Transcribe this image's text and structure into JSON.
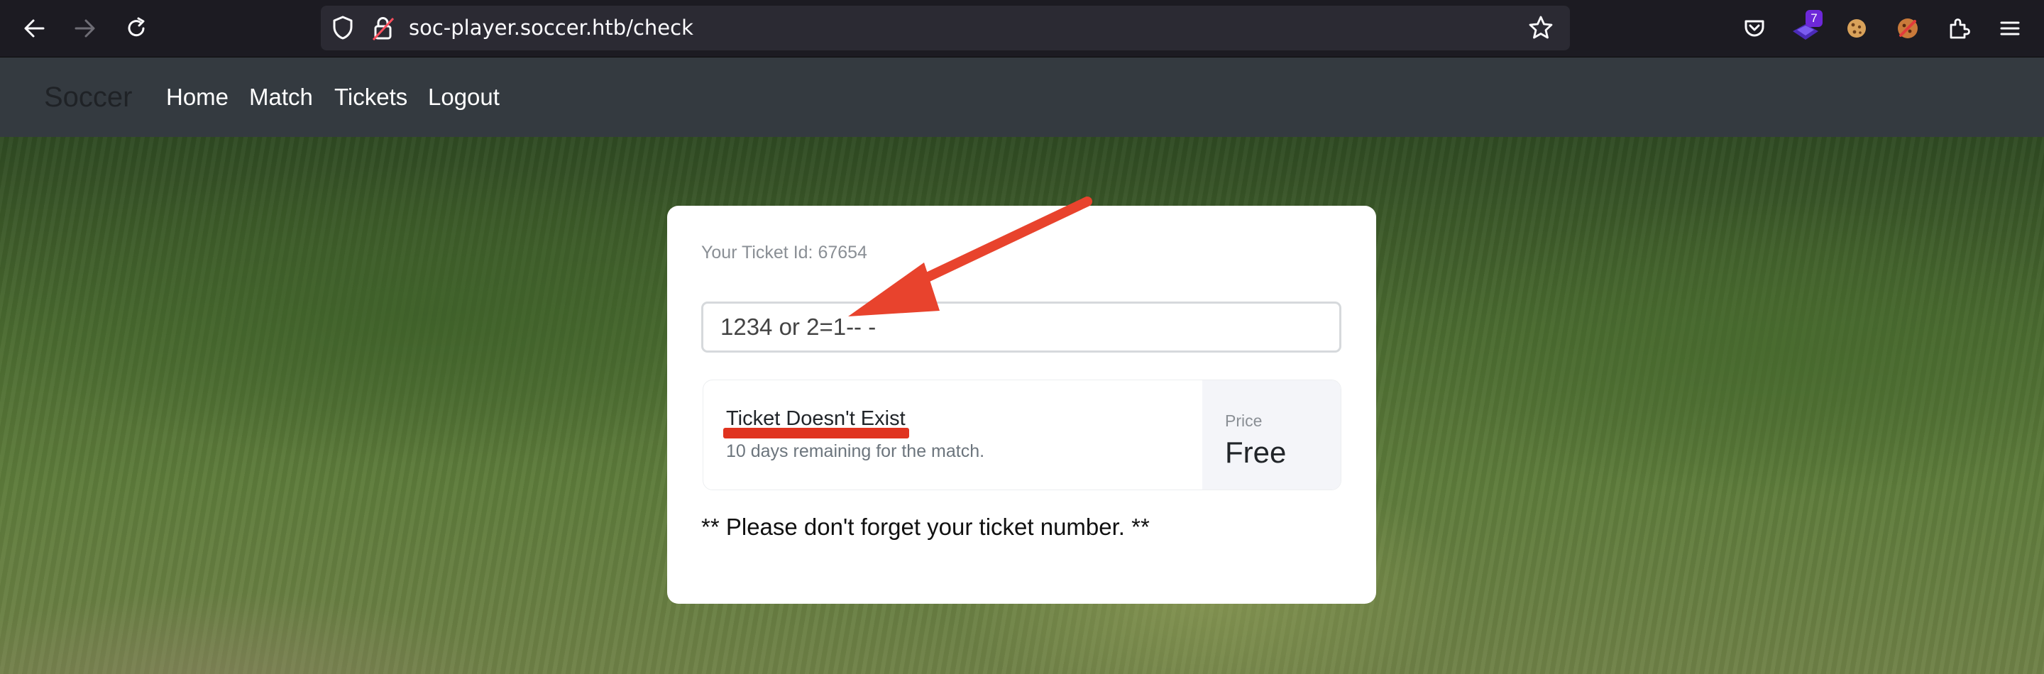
{
  "browser": {
    "url": "soc-player.soccer.htb/check",
    "extension_badge": "7",
    "icons": [
      "back-icon",
      "forward-icon",
      "reload-icon",
      "shield-icon",
      "insecure-lock-icon",
      "bookmark-star-icon",
      "pocket-icon",
      "extension-badge-icon",
      "cookie-icon",
      "cookie-editor-icon",
      "extensions-puzzle-icon",
      "menu-icon"
    ]
  },
  "site": {
    "brand": "Soccer",
    "nav": [
      "Home",
      "Match",
      "Tickets",
      "Logout"
    ]
  },
  "card": {
    "ticket_id_label": "Your Ticket Id: 67654",
    "input_value": "1234 or 2=1-- -",
    "result_status": "Ticket Doesn't Exist",
    "result_remaining": "10 days remaining for the match.",
    "price_label": "Price",
    "price_value": "Free",
    "reminder": "** Please don't forget your ticket number. **"
  },
  "annotation_colors": {
    "arrow": "#e8432d",
    "underline": "#e0331f"
  }
}
